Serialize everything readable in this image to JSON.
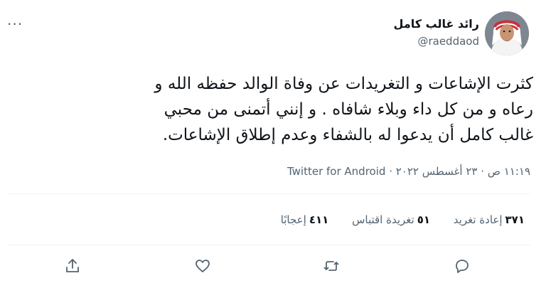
{
  "author": {
    "name": "رائد غالب كامل",
    "handle": "@raeddaod"
  },
  "tweet": {
    "text": "كثرت الإشاعات و التغريدات عن وفاة الوالد حفظه الله و رعاه و من كل داء وبلاء شافاه . و إنني أتمنى من محبي غالب كامل أن يدعوا له بالشفاء وعدم إطلاق الإشاعات.",
    "time": "١١:١٩ ص",
    "date": "٢٣ أغسطس ٢٠٢٢",
    "separator": "·",
    "source": "Twitter for Android"
  },
  "stats": {
    "retweets_count": "٣٧١",
    "retweets_label": "إعادة تغريد",
    "quotes_count": "٥١",
    "quotes_label": "تغريدة اقتباس",
    "likes_count": "٤١١",
    "likes_label": "إعجابًا"
  },
  "icons": {
    "more": "more-icon",
    "reply": "reply-icon",
    "retweet": "retweet-icon",
    "like": "like-icon",
    "share": "share-icon"
  }
}
